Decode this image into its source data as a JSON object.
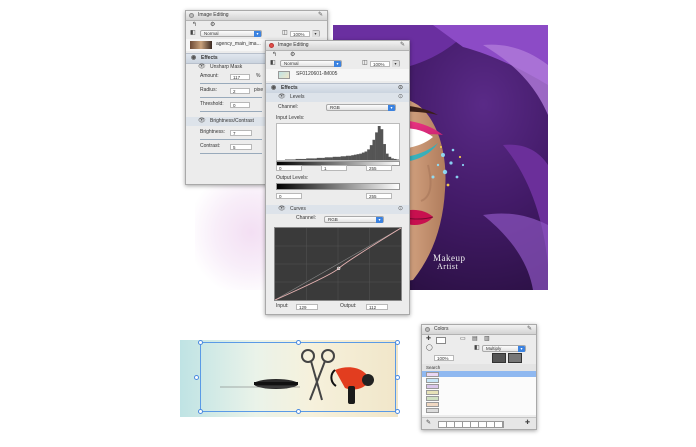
{
  "windows": {
    "image_editing_back": {
      "title": "Image Editing",
      "blend_mode": "Normal",
      "opacity": "100%",
      "layer_name": "agency_main_ima...",
      "effects_header": "Effects",
      "unsharp": {
        "label": "Unsharp Mask",
        "amount_label": "Amount:",
        "amount_value": "117",
        "amount_unit": "%",
        "radius_label": "Radius:",
        "radius_value": "2",
        "radius_unit": "pixe",
        "threshold_label": "Threshold:",
        "threshold_value": "0"
      },
      "brightness": {
        "label": "Brightness/Contrast",
        "brightness_label": "Brightness:",
        "brightness_value": "7",
        "contrast_label": "Contrast:",
        "contrast_value": "5"
      }
    },
    "image_editing_front": {
      "title": "Image Editing",
      "blend_mode": "Normal",
      "opacity": "100%",
      "layer_name": "SF0120601-IM005",
      "effects_header": "Effects",
      "levels": {
        "label": "Levels",
        "channel_label": "Channel:",
        "channel_value": "RGB",
        "input_levels_label": "Input Levels:",
        "input_low": "0",
        "input_mid": "1",
        "input_high": "255",
        "output_levels_label": "Output Levels:",
        "output_low": "0",
        "output_high": "255",
        "histogram": [
          0,
          0,
          0,
          1,
          1,
          1,
          1,
          2,
          2,
          2,
          2,
          3,
          3,
          3,
          3,
          4,
          4,
          4,
          5,
          5,
          5,
          6,
          6,
          6,
          7,
          7,
          8,
          8,
          9,
          10,
          11,
          12,
          14,
          16,
          20,
          28,
          38,
          52,
          64,
          58,
          30,
          12,
          6,
          3,
          2,
          1
        ]
      },
      "curves": {
        "label": "Curves",
        "channel_label": "Channel:",
        "channel_value": "RGB",
        "input_label": "Input:",
        "input_value": "129",
        "output_label": "Output:",
        "output_value": "112",
        "curve_point": [
          129,
          112
        ]
      }
    },
    "colors": {
      "title": "Colors",
      "blend_mode": "Multiply",
      "opacity": "100%",
      "search_label": "Search",
      "swatch_colors": [
        "#e9d7f4",
        "#c7e6f7",
        "#d9c6ea",
        "#e6e2b8",
        "#cfe0c2",
        "#f0d8c2",
        "#dcdcdc"
      ]
    }
  },
  "poster": {
    "brand_line1": "Makeup",
    "brand_line2": "Artist"
  },
  "colors": {
    "accent": "#3b82e0",
    "section_bg": "#d3dbe5",
    "panel_bg": "#ececec",
    "poster_purple": "#5b2a86"
  }
}
